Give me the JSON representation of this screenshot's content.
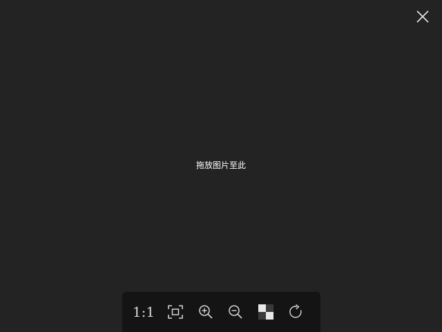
{
  "viewer": {
    "drop_hint": "拖放图片至此",
    "background_color": "#232323"
  },
  "close_button": {
    "icon": "close-icon"
  },
  "toolbar": {
    "background_color": "#141414",
    "actual_size_label": "1:1",
    "tools": [
      {
        "name": "actual-size-button",
        "icon": "text-1to1"
      },
      {
        "name": "fit-to-window-button",
        "icon": "fit-screen-icon"
      },
      {
        "name": "zoom-in-button",
        "icon": "zoom-in-icon"
      },
      {
        "name": "zoom-out-button",
        "icon": "zoom-out-icon"
      },
      {
        "name": "toggle-background-button",
        "icon": "checkerboard-icon"
      },
      {
        "name": "rotate-button",
        "icon": "rotate-clockwise-icon"
      }
    ]
  }
}
